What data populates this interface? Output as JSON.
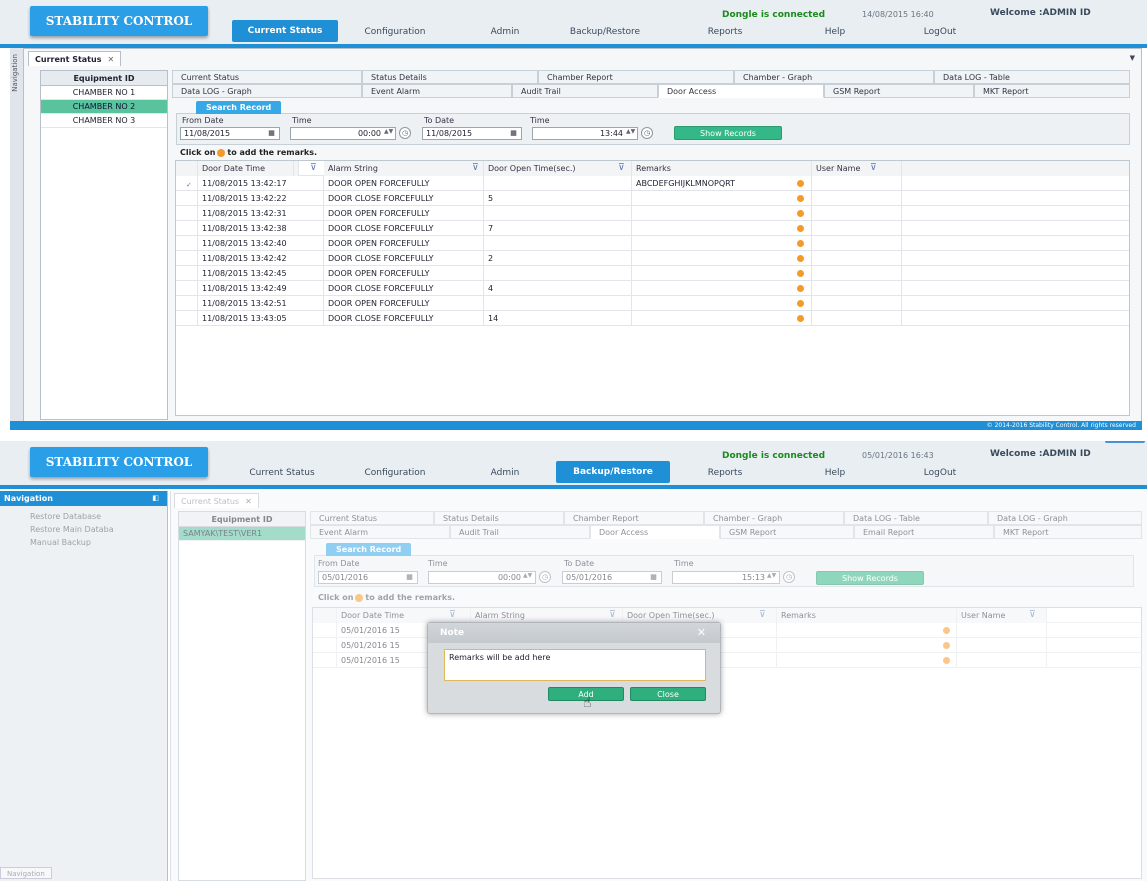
{
  "app": {
    "logo": "STABILITY CONTROL",
    "nav": [
      "Current Status",
      "Configuration",
      "Admin",
      "Backup/Restore",
      "Reports",
      "Help",
      "LogOut"
    ],
    "dongle": "Dongle is connected",
    "welcome": "Welcome :ADMIN ID",
    "dropdown_icon": "triangle-down-icon"
  },
  "screen1": {
    "active_nav": "Current Status",
    "datetime": "14/08/2015 16:40",
    "navigation_strip": "Navigation",
    "open_tab": "Current Status",
    "equipment_header": "Equipment ID",
    "equipment": [
      "CHAMBER NO 1",
      "CHAMBER NO 2",
      "CHAMBER NO 3"
    ],
    "selected_equipment": "CHAMBER NO 2",
    "tabs_row1": [
      "Current Status",
      "Status Details",
      "Chamber Report",
      "Chamber - Graph",
      "Data LOG - Table"
    ],
    "tabs_row2": [
      "Data LOG - Graph",
      "Event Alarm",
      "Audit Trail",
      "Door Access",
      "GSM Report",
      "MKT Report"
    ],
    "active_tab": "Door Access",
    "search": {
      "title": "Search Record",
      "from_date_label": "From Date",
      "from_date": "11/08/2015",
      "time_label": "Time",
      "from_time": "00:00",
      "to_date_label": "To Date",
      "to_date": "11/08/2015",
      "to_time_label": "Time",
      "to_time": "13:44",
      "show_button": "Show Records"
    },
    "hint_pre": "Click on",
    "hint_post": "to add the remarks.",
    "columns": [
      "Door Date Time",
      "Alarm String",
      "Door Open Time(sec.)",
      "Remarks",
      "User Name"
    ],
    "rows": [
      [
        "11/08/2015 13:42:17",
        "DOOR OPEN FORCEFULLY",
        "",
        "ABCDEFGHIJKLMNOPQRT"
      ],
      [
        "11/08/2015 13:42:22",
        "DOOR CLOSE FORCEFULLY",
        "5",
        ""
      ],
      [
        "11/08/2015 13:42:31",
        "DOOR OPEN FORCEFULLY",
        "",
        ""
      ],
      [
        "11/08/2015 13:42:38",
        "DOOR CLOSE FORCEFULLY",
        "7",
        ""
      ],
      [
        "11/08/2015 13:42:40",
        "DOOR OPEN FORCEFULLY",
        "",
        ""
      ],
      [
        "11/08/2015 13:42:42",
        "DOOR CLOSE FORCEFULLY",
        "2",
        ""
      ],
      [
        "11/08/2015 13:42:45",
        "DOOR OPEN FORCEFULLY",
        "",
        ""
      ],
      [
        "11/08/2015 13:42:49",
        "DOOR CLOSE FORCEFULLY",
        "4",
        ""
      ],
      [
        "11/08/2015 13:42:51",
        "DOOR OPEN FORCEFULLY",
        "",
        ""
      ],
      [
        "11/08/2015 13:43:05",
        "DOOR CLOSE FORCEFULLY",
        "14",
        ""
      ]
    ],
    "footer": "© 2014-2016 Stability Control. All rights reserved"
  },
  "screen2": {
    "active_nav": "Backup/Restore",
    "datetime": "05/01/2016 16:43",
    "navigation_header": "Navigation",
    "navigation_items": [
      "Restore Database",
      "Restore Main Databa",
      "Manual Backup"
    ],
    "navigation_footer": "Navigation",
    "open_tab": "Current Status",
    "equipment_header": "Equipment ID",
    "equipment": [
      "SAMYAK\\TEST\\VER1"
    ],
    "tabs_row1": [
      "Current Status",
      "Status Details",
      "Chamber Report",
      "Chamber - Graph",
      "Data LOG - Table",
      "Data LOG - Graph"
    ],
    "tabs_row2": [
      "Event Alarm",
      "Audit Trail",
      "Door Access",
      "GSM Report",
      "Email Report",
      "MKT Report"
    ],
    "active_tab": "Door Access",
    "search": {
      "title": "Search Record",
      "from_date_label": "From Date",
      "from_date": "05/01/2016",
      "time_label": "Time",
      "from_time": "00:00",
      "to_date_label": "To Date",
      "to_date": "05/01/2016",
      "to_time_label": "Time",
      "to_time": "15:13",
      "show_button": "Show Records"
    },
    "hint_pre": "Click on",
    "hint_post": "to add the remarks.",
    "columns": [
      "Door Date Time",
      "Alarm String",
      "Door Open Time(sec.)",
      "Remarks",
      "User Name"
    ],
    "rows": [
      [
        "05/01/2016 15"
      ],
      [
        "05/01/2016 15"
      ],
      [
        "05/01/2016 15"
      ]
    ],
    "dialog": {
      "title": "Note",
      "close_icon": "close-icon",
      "text": "Remarks will be add here",
      "add_button": "Add",
      "close_button": "Close",
      "title_color": "#2a9ee6"
    }
  }
}
